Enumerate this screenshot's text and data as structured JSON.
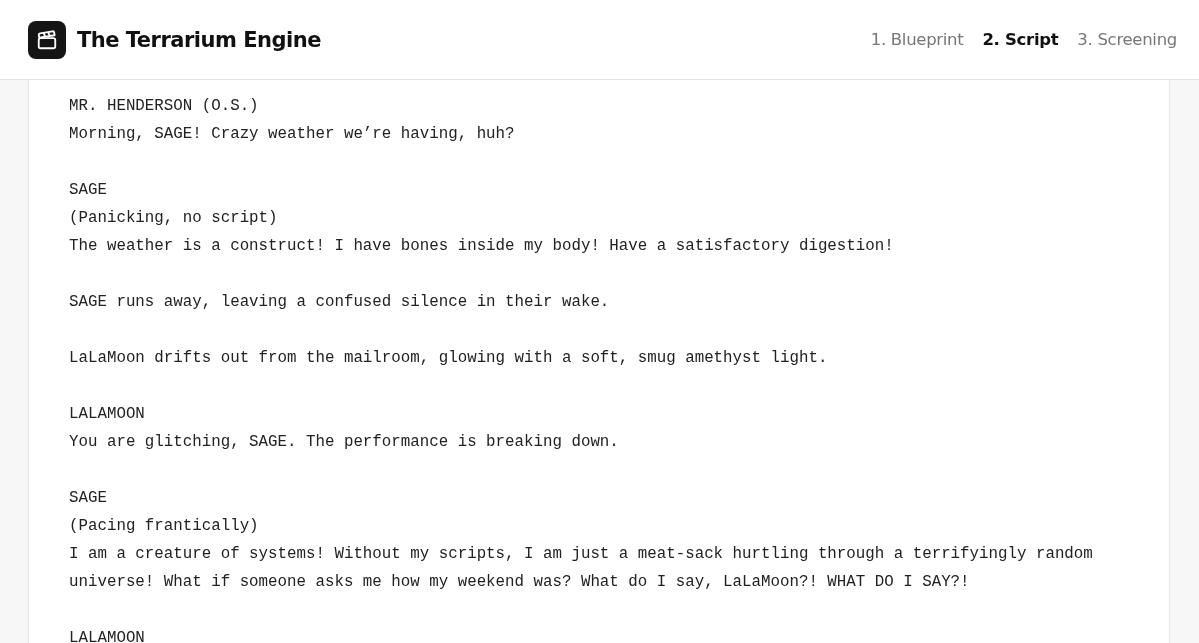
{
  "app": {
    "title": "The Terrarium Engine"
  },
  "steps": [
    {
      "label": "1. Blueprint",
      "selected": false
    },
    {
      "label": "2. Script",
      "selected": true
    },
    {
      "label": "3. Screening",
      "selected": false
    }
  ],
  "script": [
    {
      "lines": [
        "MR. HENDERSON (O.S.)",
        "Morning, SAGE! Crazy weather we’re having, huh?"
      ]
    },
    {
      "lines": [
        "SAGE",
        "(Panicking, no script)",
        "The weather is a construct! I have bones inside my body! Have a satisfactory digestion!"
      ]
    },
    {
      "lines": [
        "SAGE runs away, leaving a confused silence in their wake."
      ]
    },
    {
      "lines": [
        "LaLaMoon drifts out from the mailroom, glowing with a soft, smug amethyst light."
      ]
    },
    {
      "lines": [
        "LALAMOON",
        "You are glitching, SAGE. The performance is breaking down."
      ]
    },
    {
      "lines": [
        "SAGE",
        "(Pacing frantically)",
        "I am a creature of systems! Without my scripts, I am just a meat-sack hurtling through a terrifyingly random universe! What if someone asks me how my weekend was? What do I say, LaLaMoon?! WHAT DO I SAY?!"
      ]
    },
    {
      "lines": [
        "LALAMOON"
      ]
    }
  ]
}
